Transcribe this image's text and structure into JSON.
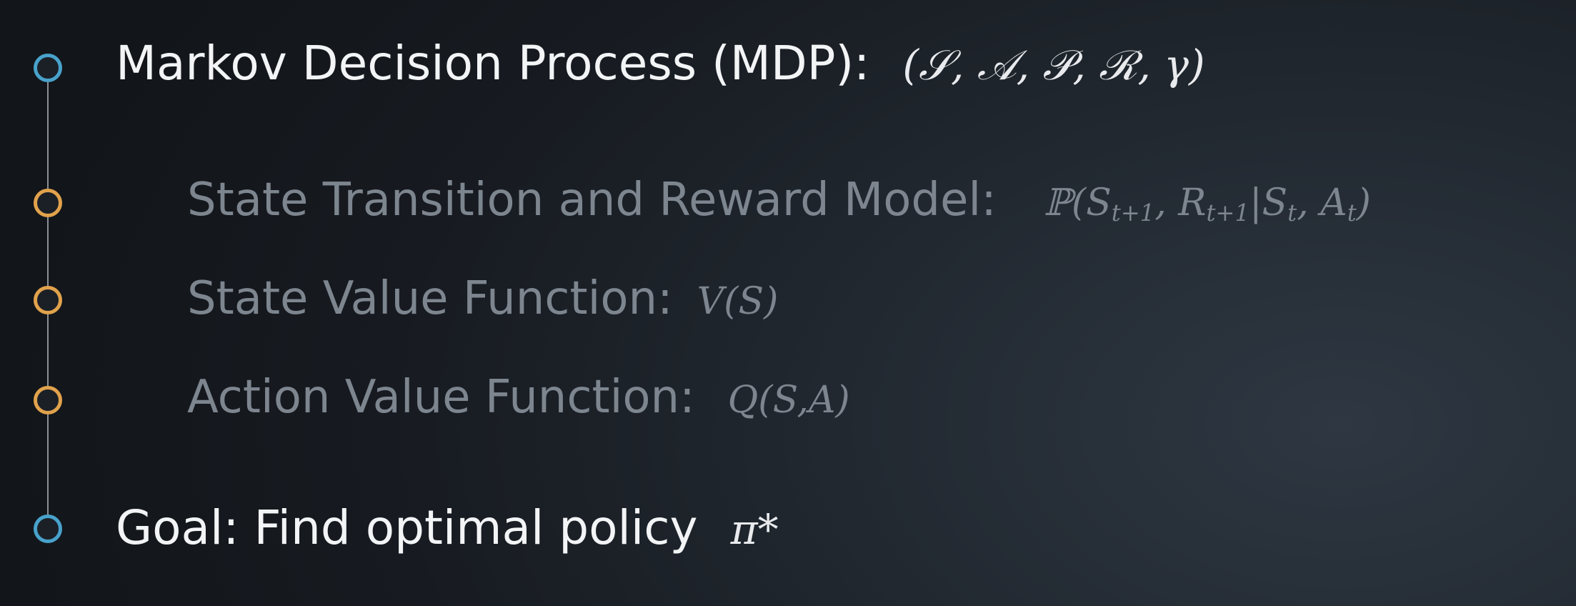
{
  "items": [
    {
      "label": "Markov Decision Process (MDP):",
      "formula": "(𝒮, 𝒜, 𝒫, ℛ, γ)",
      "level": "primary",
      "bullet_color": "#48a2cb"
    },
    {
      "label": "State Transition and Reward Model:",
      "formula_prefix": "ℙ(",
      "formula_s": "S",
      "formula_s_sub": "t+1",
      "formula_r": ", R",
      "formula_r_sub": "t+1",
      "formula_given": "|S",
      "formula_given_sub": "t",
      "formula_a": ", A",
      "formula_a_sub": "t",
      "formula_suffix": ")",
      "level": "secondary",
      "bullet_color": "#e1a24c"
    },
    {
      "label": "State Value Function:",
      "formula": "V(S)",
      "level": "secondary",
      "bullet_color": "#e1a24c"
    },
    {
      "label": "Action Value Function:",
      "formula": "Q(S,A)",
      "level": "secondary",
      "bullet_color": "#e1a24c"
    },
    {
      "label": "Goal: Find optimal policy",
      "formula": "π*",
      "level": "primary",
      "bullet_color": "#48a2cb"
    }
  ]
}
